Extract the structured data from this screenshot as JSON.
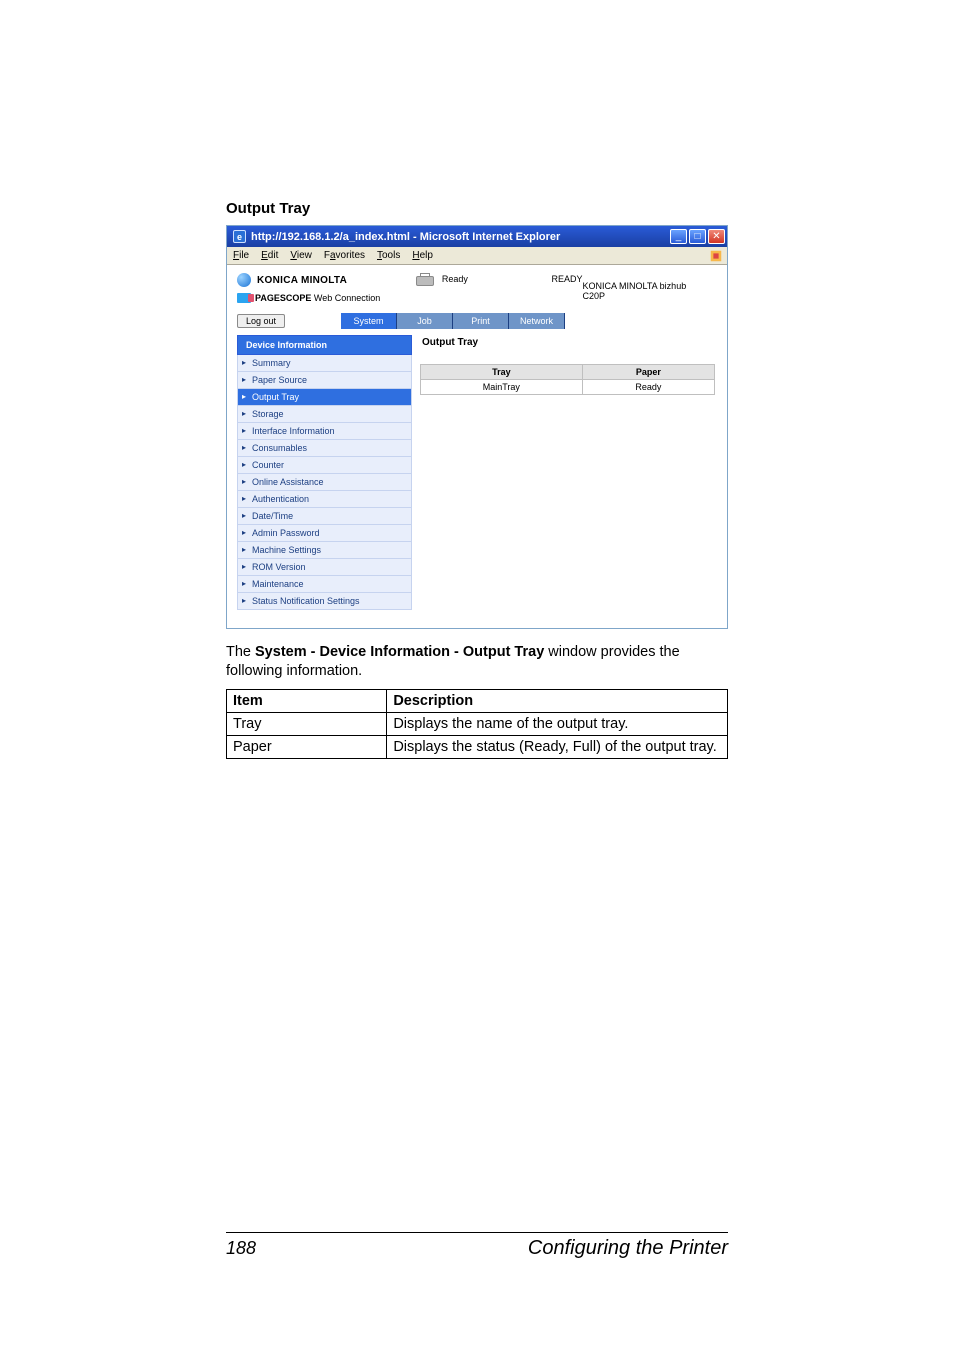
{
  "section_heading": "Output Tray",
  "window": {
    "title": "http://192.168.1.2/a_index.html - Microsoft Internet Explorer",
    "menu": {
      "file": "File",
      "edit": "Edit",
      "view": "View",
      "favorites": "Favorites",
      "tools": "Tools",
      "help": "Help"
    },
    "brand": "KONICA MINOLTA",
    "pwc_label_prefix": "PAGESCOPE",
    "pwc_label_main": " Web Connection",
    "status_ready": "Ready",
    "status_center": "READY",
    "model": "KONICA MINOLTA bizhub C20P",
    "logout": "Log out",
    "tabs": {
      "system": "System",
      "job": "Job",
      "print": "Print",
      "network": "Network"
    },
    "sidebar": {
      "head": "Device Information",
      "items": [
        "Summary",
        "Paper Source",
        "Output Tray",
        "Storage",
        "Interface Information",
        "Consumables"
      ],
      "top_items": [
        "Counter",
        "Online Assistance",
        "Authentication",
        "Date/Time",
        "Admin Password",
        "Machine Settings",
        "ROM Version",
        "Maintenance",
        "Status Notification Settings"
      ]
    },
    "main": {
      "title": "Output Tray",
      "th_tray": "Tray",
      "th_paper": "Paper",
      "td_tray": "MainTray",
      "td_paper": "Ready"
    }
  },
  "doc_text_a": "The ",
  "doc_text_b": "System - Device Information - Output Tray",
  "doc_text_c": " window provides the following information.",
  "doc_table": {
    "h1": "Item",
    "h2": "Description",
    "r1c1": "Tray",
    "r1c2": "Displays the name of the output tray.",
    "r2c1": "Paper",
    "r2c2": "Displays the status (Ready, Full) of the output tray."
  },
  "footer": {
    "page": "188",
    "title": "Configuring the Printer"
  }
}
